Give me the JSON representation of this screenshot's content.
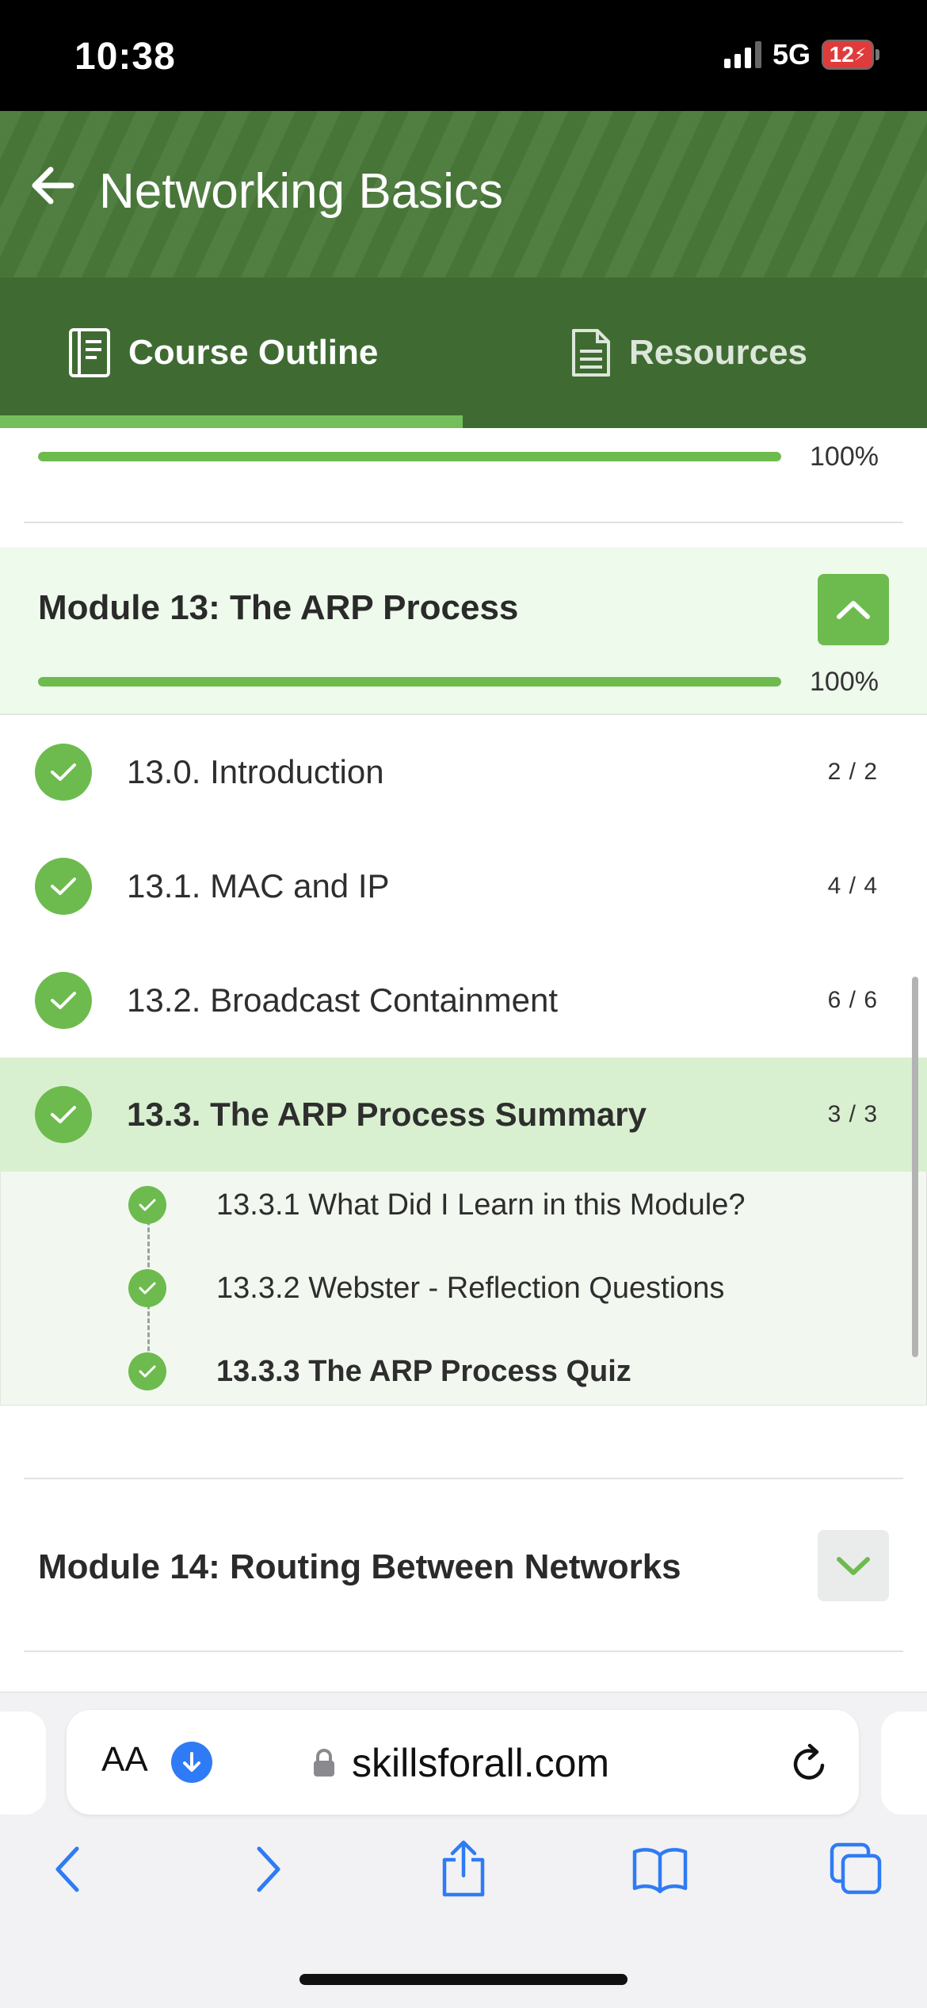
{
  "status_bar": {
    "time": "10:38",
    "network": "5G",
    "battery": "12"
  },
  "header": {
    "title": "Networking Basics"
  },
  "tabs": [
    {
      "label": "Course Outline",
      "selected": true
    },
    {
      "label": "Resources",
      "selected": false
    }
  ],
  "previous_module": {
    "progress_pct": 100,
    "progress_label": "100%"
  },
  "module_13": {
    "title": "Module 13: The ARP Process",
    "progress_pct": 100,
    "progress_label": "100%",
    "expanded": true,
    "lessons": [
      {
        "label": "13.0. Introduction",
        "count": "2 / 2",
        "complete": true
      },
      {
        "label": "13.1. MAC and IP",
        "count": "4 / 4",
        "complete": true
      },
      {
        "label": "13.2. Broadcast Containment",
        "count": "6 / 6",
        "complete": true
      },
      {
        "label": "13.3. The ARP Process Summary",
        "count": "3 / 3",
        "complete": true
      }
    ],
    "subitems": [
      {
        "label": "13.3.1 What Did I Learn in this Module?",
        "complete": true
      },
      {
        "label": "13.3.2 Webster - Reflection Questions",
        "complete": true
      },
      {
        "label": "13.3.3 The ARP Process Quiz",
        "complete": true
      }
    ]
  },
  "module_14": {
    "title": "Module 14: Routing Between Networks",
    "expanded": false
  },
  "browser": {
    "aa": "AA",
    "url": "skillsforall.com"
  },
  "colors": {
    "accent": "#6dbb4e",
    "header": "#4a7a3a",
    "tabbar": "#3f6b32",
    "active_row": "#d9f0d0"
  }
}
